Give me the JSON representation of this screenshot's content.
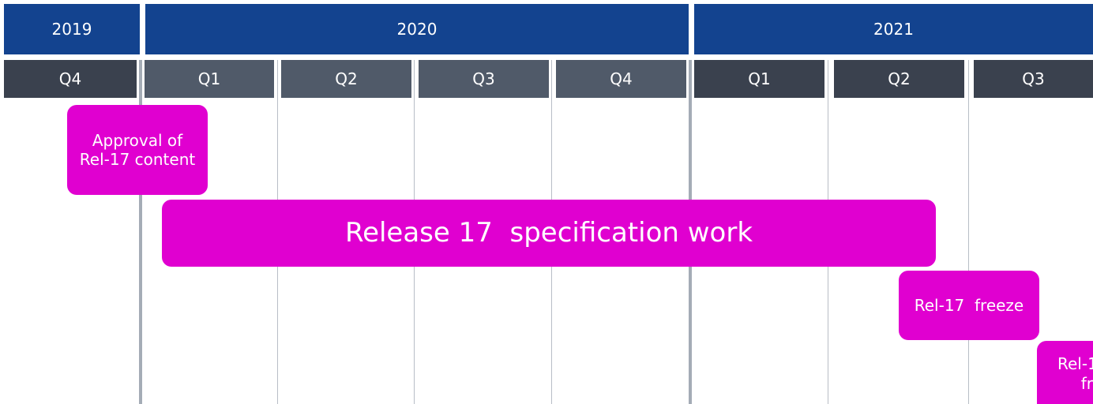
{
  "colors": {
    "year": "#13438f",
    "quarter_dark": "#3a414e",
    "quarter_mid": "#505a69",
    "accent": "#e000d0"
  },
  "years": [
    "2019",
    "2020",
    "2021"
  ],
  "quarters": [
    "Q4",
    "Q1",
    "Q2",
    "Q3",
    "Q4",
    "Q1",
    "Q2",
    "Q3"
  ],
  "milestones": {
    "approval": "Approval of Rel-17 content",
    "spec_work": "Release 17  specification work",
    "freeze": "Rel-17  freeze",
    "cut_off_line1": "Rel-1",
    "cut_off_line2": "fr"
  }
}
